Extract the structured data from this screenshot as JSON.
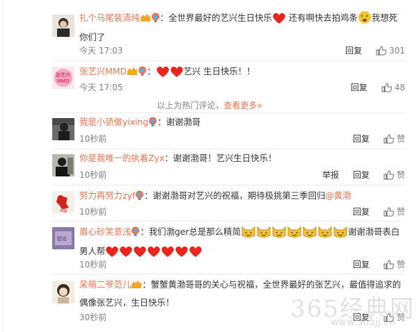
{
  "colors": {
    "accent": "#eb7350",
    "text": "#333333",
    "muted": "#808080"
  },
  "comments": [
    {
      "user": "扎个马尾装清纯",
      "text_1": "：全世界最好的艺兴生日快乐",
      "text_2": " 还有啊快去拍鸡条",
      "text_3": "我想死",
      "text_4": "你们了",
      "time": "今天 17:03",
      "reply": "回复",
      "likes": "301"
    },
    {
      "user": "张艺兴MMD",
      "text_1": "艺兴 生日快乐！！",
      "time": "今天 17:05",
      "reply": "回复",
      "likes": "48"
    },
    {
      "user": "我是小骄傲yixing",
      "text_1": "：谢谢渤哥",
      "time": "10秒前",
      "reply": "回复",
      "likes": "赞"
    },
    {
      "user": "你是我唯一的执着Zyx",
      "text_1": "：谢谢渤哥！艺兴生日快乐！",
      "time": "10秒前",
      "report": "举报",
      "reply": "回复",
      "likes": "赞"
    },
    {
      "user": "努力再努力zyf",
      "text_1": "：谢谢渤哥对艺兴的祝福，期待极挑第三季回归",
      "mention": "@黄渤",
      "time": "10秒前",
      "reply": "回复",
      "likes": "赞"
    },
    {
      "user": "眉心砂笑意浅",
      "text_1": "：我们渤ger总是那么精简",
      "text_2": "谢谢渤哥表白",
      "text_3": "男人帮",
      "time": "10秒前",
      "reply": "回复",
      "likes": "赞"
    },
    {
      "user": "呆萌二爷范儿",
      "text_1": "：蟹蟹黄渤哥哥的关心与祝福，全世界最好的张艺兴，最值得追求的",
      "text_2": "偶像张艺兴，生日快乐！",
      "time": "30秒前",
      "reply": "回复",
      "likes": "赞"
    }
  ],
  "hot_divider": {
    "text": "以上为热门评论，",
    "link": "查看更多»"
  },
  "watermark": {
    "main": "365经典网",
    "sub": "www.365jj.cn"
  }
}
